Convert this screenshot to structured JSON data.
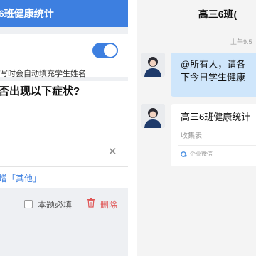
{
  "left_panel": {
    "header_title": "6班健康统计",
    "autofill_hint": "写时会自动填充学生姓名",
    "question": "否出现以下症状?",
    "add_other_label": "增「其他」",
    "required_label": "本题必填",
    "delete_label": "删除",
    "toggle_on": true,
    "accent_color": "#3d7fe0",
    "delete_color": "#e05555"
  },
  "chat": {
    "title": "高三6班(",
    "time": "上午9:5",
    "message_lines": [
      "@所有人，请各",
      "下今日学生健康"
    ],
    "card": {
      "title": "高三6班健康统计",
      "subtitle": "收集表",
      "source": "企业微信"
    },
    "bubble_color": "#cfe6fb"
  }
}
